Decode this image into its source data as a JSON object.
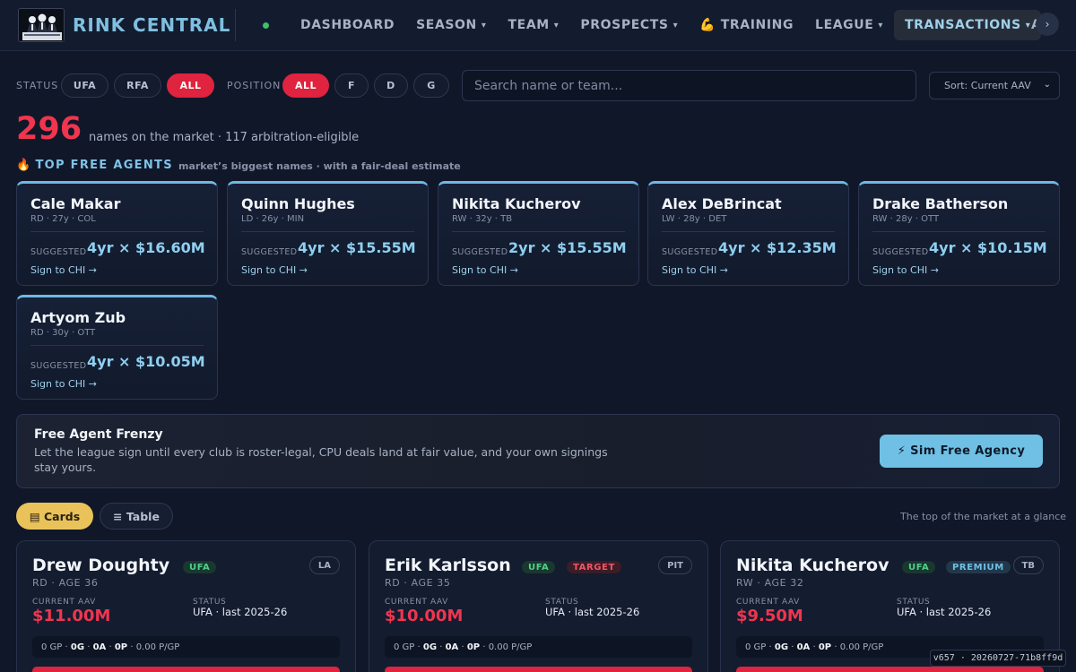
{
  "app": {
    "brand": "RINK CENTRAL",
    "logo_icon": "team-logo",
    "live_indicator_color": "#3fbf6a",
    "accent": "#e0233e",
    "highlight": "#6fc0e4"
  },
  "nav": {
    "items": [
      {
        "label": "DASHBOARD",
        "caret": ""
      },
      {
        "label": "SEASON",
        "caret": "▾"
      },
      {
        "label": "TEAM",
        "caret": "▾"
      },
      {
        "label": "PROSPECTS",
        "caret": "▾"
      },
      {
        "label": "💪 TRAINING",
        "caret": ""
      },
      {
        "label": "LEAGUE",
        "caret": "▾"
      },
      {
        "label": "TRANSACTIONS",
        "caret": "▾",
        "active": true
      }
    ],
    "overflow_partial": "A",
    "scroll_arrow": "›"
  },
  "filters": {
    "status_label": "STATUS",
    "status_options": [
      "UFA",
      "RFA",
      "ALL"
    ],
    "status_selected": "ALL",
    "position_label": "POSITION",
    "position_options": [
      "ALL",
      "F",
      "D",
      "G"
    ],
    "position_selected": "ALL",
    "search_placeholder": "Search name or team...",
    "search_value": "",
    "sort_value": "Sort: Current AAV",
    "sort_chevron": "⌄"
  },
  "market": {
    "count": "296",
    "summary": "names on the market · 117 arbitration-eligible"
  },
  "top_free_agents": {
    "icon": "🔥",
    "title": "TOP FREE AGENTS",
    "subtitle": "market’s biggest names · with a fair-deal estimate",
    "suggested_label": "SUGGESTED",
    "players": [
      {
        "name": "Cale Makar",
        "meta": "RD · 27y · COL",
        "deal": "4yr × $16.60M",
        "action": "Sign to CHI →"
      },
      {
        "name": "Quinn Hughes",
        "meta": "LD · 26y · MIN",
        "deal": "4yr × $15.55M",
        "action": "Sign to CHI →"
      },
      {
        "name": "Nikita Kucherov",
        "meta": "RW · 32y · TB",
        "deal": "2yr × $15.55M",
        "action": "Sign to CHI →"
      },
      {
        "name": "Alex DeBrincat",
        "meta": "LW · 28y · DET",
        "deal": "4yr × $12.35M",
        "action": "Sign to CHI →"
      },
      {
        "name": "Drake Batherson",
        "meta": "RW · 28y · OTT",
        "deal": "4yr × $10.15M",
        "action": "Sign to CHI →"
      },
      {
        "name": "Artyom Zub",
        "meta": "RD · 30y · OTT",
        "deal": "4yr × $10.05M",
        "action": "Sign to CHI →"
      }
    ]
  },
  "frenzy": {
    "title": "Free Agent Frenzy",
    "description": "Let the league sign until every club is roster-legal, CPU deals land at fair value, and your own signings stay yours.",
    "button": "⚡ Sim Free Agency"
  },
  "view": {
    "cards_label": "▤ Cards",
    "table_label": "≡ Table",
    "selected": "Cards",
    "note": "The top of the market at a glance"
  },
  "player_cards": {
    "aav_label": "CURRENT AAV",
    "status_label": "STATUS",
    "items": [
      {
        "name": "Drew Doughty",
        "badges": [
          "UFA"
        ],
        "team": "LA",
        "meta": "RD · AGE 36",
        "aav": "$11.00M",
        "status": "UFA · last 2025-26",
        "gp": "0 GP",
        "g": "0G",
        "a": "0A",
        "p": "0P",
        "ppg": "0.00 P/GP"
      },
      {
        "name": "Erik Karlsson",
        "badges": [
          "UFA",
          "TARGET"
        ],
        "team": "PIT",
        "meta": "RD · AGE 35",
        "aav": "$10.00M",
        "status": "UFA · last 2025-26",
        "gp": "0 GP",
        "g": "0G",
        "a": "0A",
        "p": "0P",
        "ppg": "0.00 P/GP"
      },
      {
        "name": "Nikita Kucherov",
        "badges": [
          "UFA",
          "PREMIUM"
        ],
        "team": "TB",
        "meta": "RW · AGE 32",
        "aav": "$9.50M",
        "status": "UFA · last 2025-26",
        "gp": "0 GP",
        "g": "0G",
        "a": "0A",
        "p": "0P",
        "ppg": "0.00 P/GP"
      }
    ]
  },
  "footer": {
    "version": "v657 · 20260727-71b8ff9d"
  }
}
